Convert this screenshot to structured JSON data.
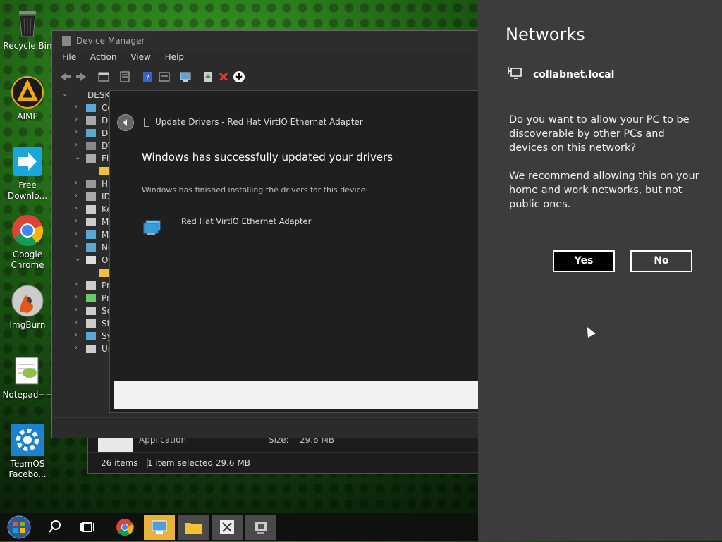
{
  "desktop": {
    "icons": [
      {
        "label_1": "Recycle Bin",
        "label_2": ""
      },
      {
        "label_1": "AIMP",
        "label_2": ""
      },
      {
        "label_1": "Free",
        "label_2": "Downlo..."
      },
      {
        "label_1": "Google",
        "label_2": "Chrome"
      },
      {
        "label_1": "ImgBurn",
        "label_2": ""
      },
      {
        "label_1": "Notepad++",
        "label_2": ""
      },
      {
        "label_1": "TeamOS",
        "label_2": "Facebo..."
      }
    ]
  },
  "explorer": {
    "file_type": "Application",
    "size_label": "Size:",
    "size_value": "29.6 MB",
    "item_count": "26 items",
    "selection": "1 item selected  29.6 MB"
  },
  "device_manager": {
    "title": "Device Manager",
    "menu": [
      "File",
      "Action",
      "View",
      "Help"
    ],
    "root_node": "DESKT",
    "tree_items": [
      "Co",
      "Di",
      "Di",
      "DV",
      "Flo",
      "",
      "Hu",
      "ID",
      "Ke",
      "M",
      "M",
      "Ne",
      "Ot",
      "",
      "Pr",
      "Pr",
      "Sc",
      "St",
      "Sy",
      "Ur"
    ]
  },
  "update_drivers": {
    "title": "Update Drivers - Red Hat VirtIO Ethernet Adapter",
    "heading": "Windows has successfully updated your drivers",
    "subtext": "Windows has finished installing the drivers for this device:",
    "device_name": "Red Hat VirtIO Ethernet Adapter"
  },
  "networks": {
    "heading": "Networks",
    "ssid": "collabnet.local",
    "question": "Do you want to allow your PC to be discoverable by other PCs and devices on this network?",
    "recommendation": "We recommend allowing this on your home and work networks, but not public ones.",
    "yes_label": "Yes",
    "no_label": "No"
  },
  "taskbar": {
    "buttons": [
      "start-icon",
      "search-icon",
      "task-view-icon",
      "chrome-icon",
      "network-setup-icon",
      "file-explorer-icon",
      "app-icon",
      "device-manager-icon"
    ]
  },
  "colors": {
    "panel_bg": "#3c3c3c",
    "window_bg": "#2b2b2b",
    "accent_green": "#3fa82a"
  }
}
